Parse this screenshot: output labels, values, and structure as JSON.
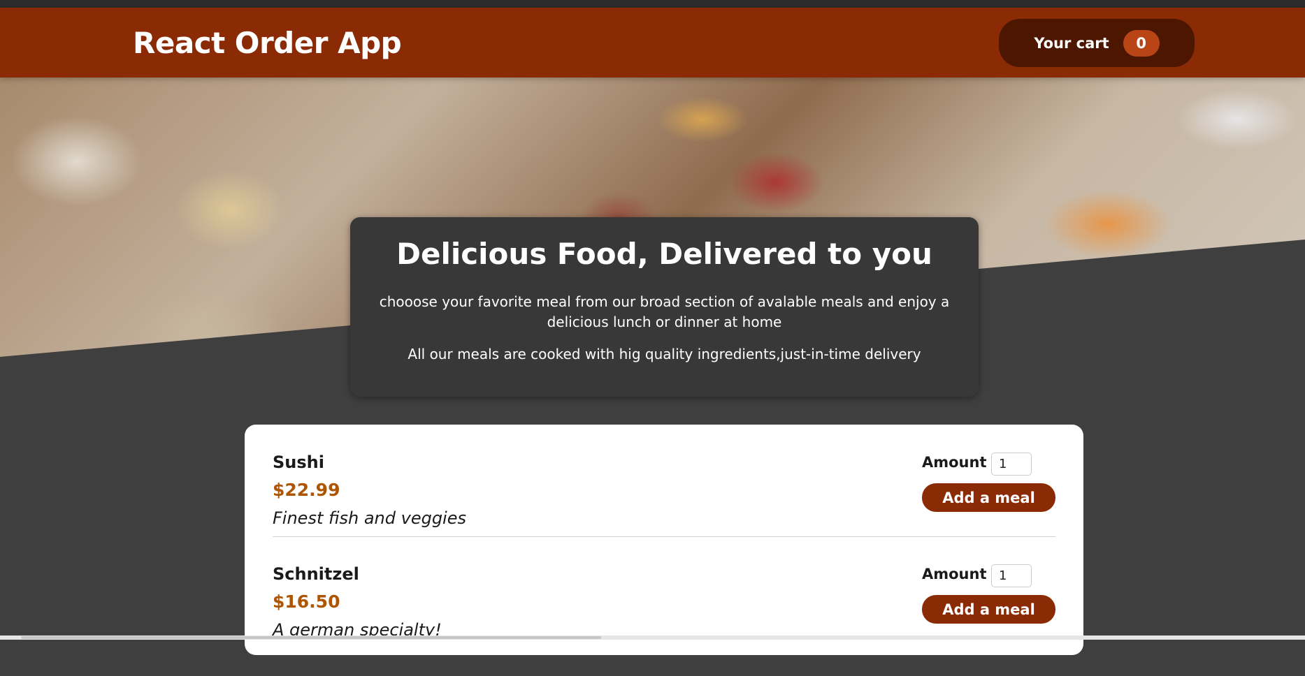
{
  "header": {
    "title": "React Order App",
    "cart_label": "Your cart",
    "cart_count": "0"
  },
  "hero": {
    "image": "food-buffet-table"
  },
  "summary": {
    "title": "Delicious Food, Delivered to you",
    "paragraph1": "chooose your favorite meal from our broad section of avalable meals and enjoy a delicious lunch or dinner at home",
    "paragraph2": "All our meals are cooked with hig quality ingredients,just-in-time delivery"
  },
  "meals": [
    {
      "name": "Sushi",
      "price": "$22.99",
      "description": "Finest fish and veggies",
      "amount_label": "Amount",
      "amount_value": "1",
      "button_label": "Add a meal"
    },
    {
      "name": "Schnitzel",
      "price": "$16.50",
      "description": "A german specialty!",
      "amount_label": "Amount",
      "amount_value": "1",
      "button_label": "Add a meal"
    }
  ],
  "colors": {
    "header_bg": "#8a2b06",
    "cart_bg": "#4d1601",
    "badge_bg": "#b94517",
    "page_bg": "#3f3f3f",
    "price": "#ad5502"
  }
}
